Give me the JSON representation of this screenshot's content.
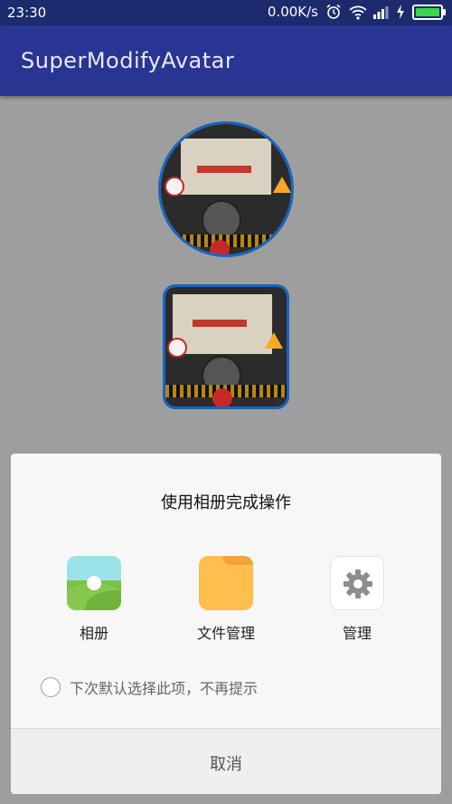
{
  "status_bar": {
    "time": "23:30",
    "net_speed": "0.00K/s",
    "icons": [
      "alarm-icon",
      "wifi-icon",
      "signal-icon",
      "charging-icon",
      "battery-icon"
    ]
  },
  "app_bar": {
    "title": "SuperModifyAvatar"
  },
  "colors": {
    "app_bar": "#283593",
    "status_bar": "#1c2a6e",
    "avatar_border": "#1565c0"
  },
  "dialog": {
    "title": "使用相册完成操作",
    "options": [
      {
        "label": "相册",
        "icon": "gallery-icon"
      },
      {
        "label": "文件管理",
        "icon": "folder-icon"
      },
      {
        "label": "管理",
        "icon": "gear-icon"
      }
    ],
    "remember_text": "下次默认选择此项，不再提示",
    "remember_checked": false,
    "cancel_label": "取消"
  }
}
